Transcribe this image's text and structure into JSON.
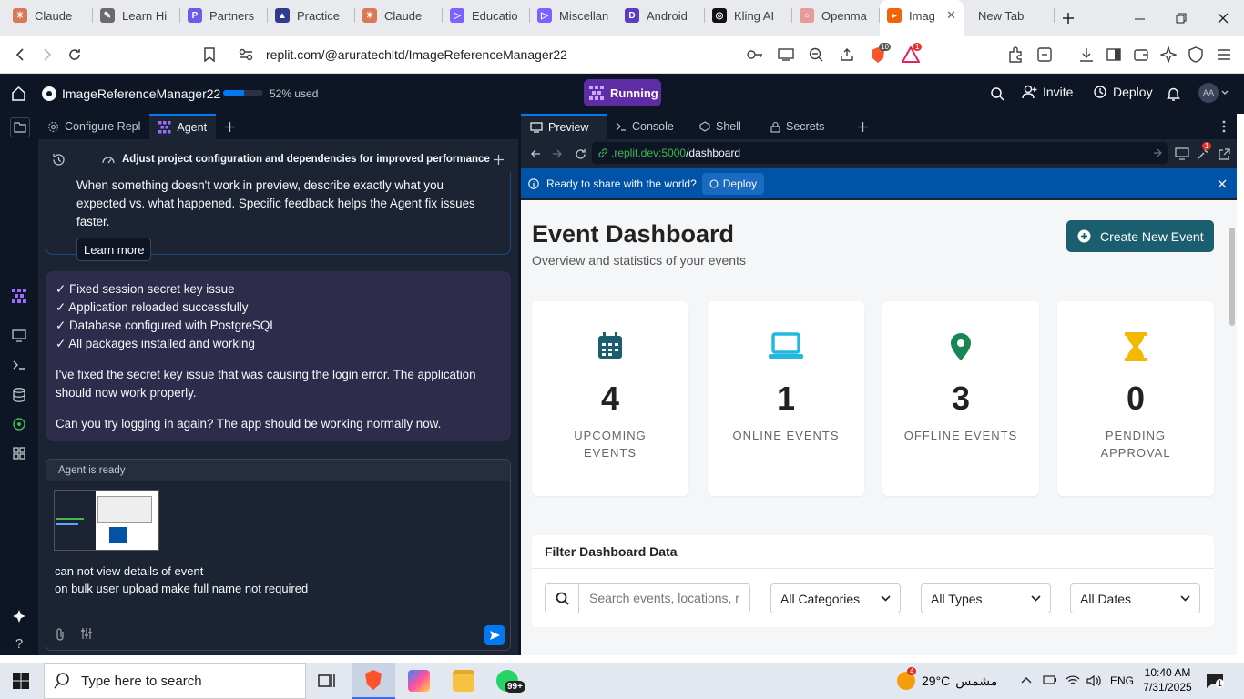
{
  "browser": {
    "tabs": [
      {
        "label": "Claude",
        "color": "#d97757",
        "glyph": "✳"
      },
      {
        "label": "Learn Hi",
        "color": "#6b6b6b",
        "glyph": "✎"
      },
      {
        "label": "Partners",
        "color": "#6c5ce7",
        "glyph": "P"
      },
      {
        "label": "Practice",
        "color": "#2f3b8f",
        "glyph": "▲"
      },
      {
        "label": "Claude",
        "color": "#d97757",
        "glyph": "✳"
      },
      {
        "label": "Educatio",
        "color": "#7b61ff",
        "glyph": "▷"
      },
      {
        "label": "Miscellan",
        "color": "#7b61ff",
        "glyph": "▷"
      },
      {
        "label": "Android",
        "color": "#5b3cc4",
        "glyph": "D"
      },
      {
        "label": "Kling AI",
        "color": "#111111",
        "glyph": "◎"
      },
      {
        "label": "Openma",
        "color": "#e89a9a",
        "glyph": "○"
      },
      {
        "label": "Imag",
        "color": "#f26207",
        "glyph": "▸"
      },
      {
        "label": "New Tab",
        "color": "",
        "glyph": ""
      }
    ],
    "url": "replit.com/@aruratechltd/ImageReferenceManager22",
    "brave_badge": "10",
    "alert_badge": "1"
  },
  "replit": {
    "project_name": "ImageReferenceManager22",
    "usage_fraction": 0.52,
    "usage_text": "52% used",
    "run_status": "Running",
    "invite_label": "Invite",
    "deploy_label": "Deploy",
    "avatar_initials": "AA",
    "left_tabs": {
      "configure": "Configure Repl",
      "agent": "Agent"
    },
    "thread_title": "Adjust project configuration and dependencies for improved performance",
    "tip_text": "When something doesn't work in preview, describe exactly what you expected vs. what happened. Specific feedback helps the Agent fix issues faster.",
    "learn_more": "Learn more",
    "message": {
      "checks": [
        "✓ Fixed session secret key issue",
        "✓ Application reloaded successfully",
        "✓ Database configured with PostgreSQL",
        "✓ All packages installed and working"
      ],
      "para1": "I've fixed the secret key issue that was causing the login error. The application should now work properly.",
      "para2": "Can you try logging in again? The app should be working normally now."
    },
    "composer": {
      "status": "Agent is ready",
      "line1": "can not view details of event",
      "line2": "on bulk user upload make full name not required"
    },
    "right_tabs": {
      "preview": "Preview",
      "console": "Console",
      "shell": "Shell",
      "secrets": "Secrets"
    },
    "preview_url_prefix": ".replit.dev:5000",
    "preview_url_path": "/dashboard",
    "preview_badge": "1",
    "banner_text": "Ready to share with the world?",
    "banner_deploy": "Deploy"
  },
  "dashboard": {
    "title": "Event Dashboard",
    "subtitle": "Overview and statistics of your events",
    "create_button": "Create New Event",
    "cards": [
      {
        "value": "4",
        "label": "UPCOMING EVENTS",
        "icon": "calendar-icon",
        "color": "#1b5e70"
      },
      {
        "value": "1",
        "label": "ONLINE EVENTS",
        "icon": "laptop-icon",
        "color": "#22b8e0"
      },
      {
        "value": "3",
        "label": "OFFLINE EVENTS",
        "icon": "map-pin-icon",
        "color": "#198754"
      },
      {
        "value": "0",
        "label": "PENDING APPROVAL",
        "icon": "hourglass-icon",
        "color": "#f5b800"
      }
    ],
    "filter_title": "Filter Dashboard Data",
    "search_placeholder": "Search events, locations, r",
    "select_categories": "All Categories",
    "select_types": "All Types",
    "select_dates": "All Dates"
  },
  "taskbar": {
    "search_placeholder": "Type here to search",
    "whatsapp_badge": "99+",
    "weather_badge": "4",
    "temperature": "29°C",
    "weather_text": "مشمس",
    "language": "ENG",
    "time": "10:40 AM",
    "date": "7/31/2025",
    "notifications": "1"
  }
}
